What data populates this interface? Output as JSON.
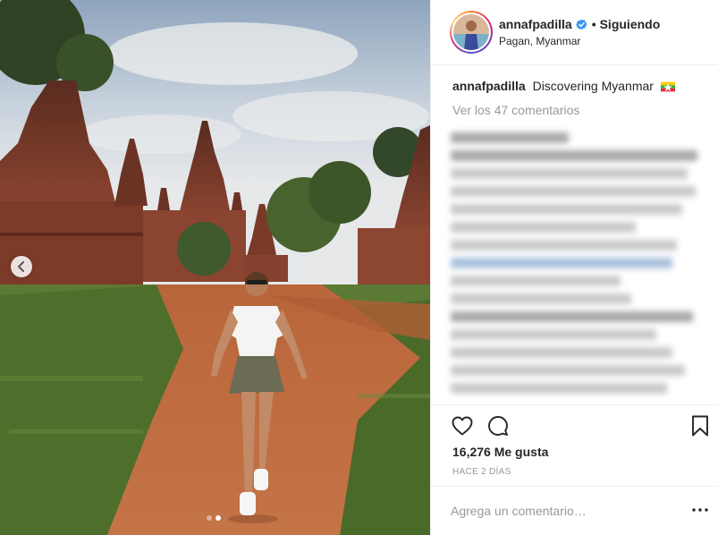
{
  "post": {
    "username": "annafpadilla",
    "follow_state": "Siguiendo",
    "bullet": "•",
    "location": "Pagan, Myanmar",
    "caption_text": "Discovering Myanmar",
    "view_comments": "Ver los 47 comentarios",
    "likes": "16,276 Me gusta",
    "timestamp": "HACE 2 DÍAS",
    "comment_placeholder": "Agrega un comentario…",
    "carousel": {
      "total": 2,
      "active_index": 1
    }
  },
  "icons": {
    "verified": "verified-badge-icon",
    "flag": "myanmar-flag-icon",
    "prev": "chevron-left-icon",
    "like": "heart-icon",
    "comment": "comment-bubble-icon",
    "save": "bookmark-icon",
    "more": "more-options-icon"
  },
  "colors": {
    "verified_blue": "#3897f0",
    "secondary_text": "#999999",
    "divider": "#efefef",
    "text": "#262626"
  }
}
